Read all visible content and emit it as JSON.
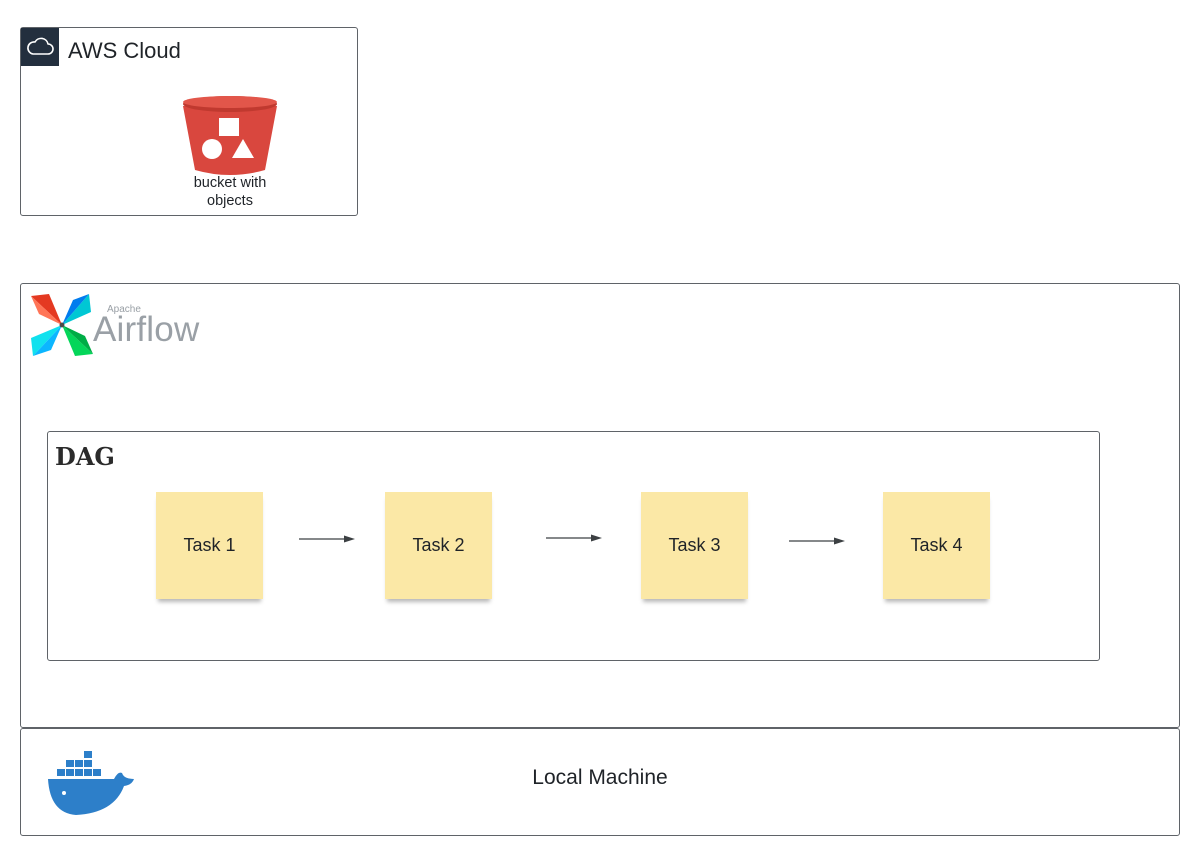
{
  "aws": {
    "title": "AWS Cloud",
    "badge_icon": "cloud-icon",
    "badge_color": "#232f3e",
    "bucket": {
      "icon": "s3-bucket-icon",
      "label_line1": "bucket with",
      "label_line2": "objects",
      "color": "#d9473e"
    }
  },
  "airflow": {
    "logo_icon": "airflow-pinwheel-icon",
    "apache_text": "Apache",
    "name_text": "Airflow",
    "dag": {
      "title": "DAG",
      "tasks": [
        {
          "label": "Task 1"
        },
        {
          "label": "Task 2"
        },
        {
          "label": "Task 3"
        },
        {
          "label": "Task 4"
        }
      ],
      "task_color": "#fbe8a6"
    }
  },
  "local": {
    "label": "Local Machine",
    "logo_icon": "docker-whale-icon",
    "logo_color": "#2d7fc9"
  }
}
